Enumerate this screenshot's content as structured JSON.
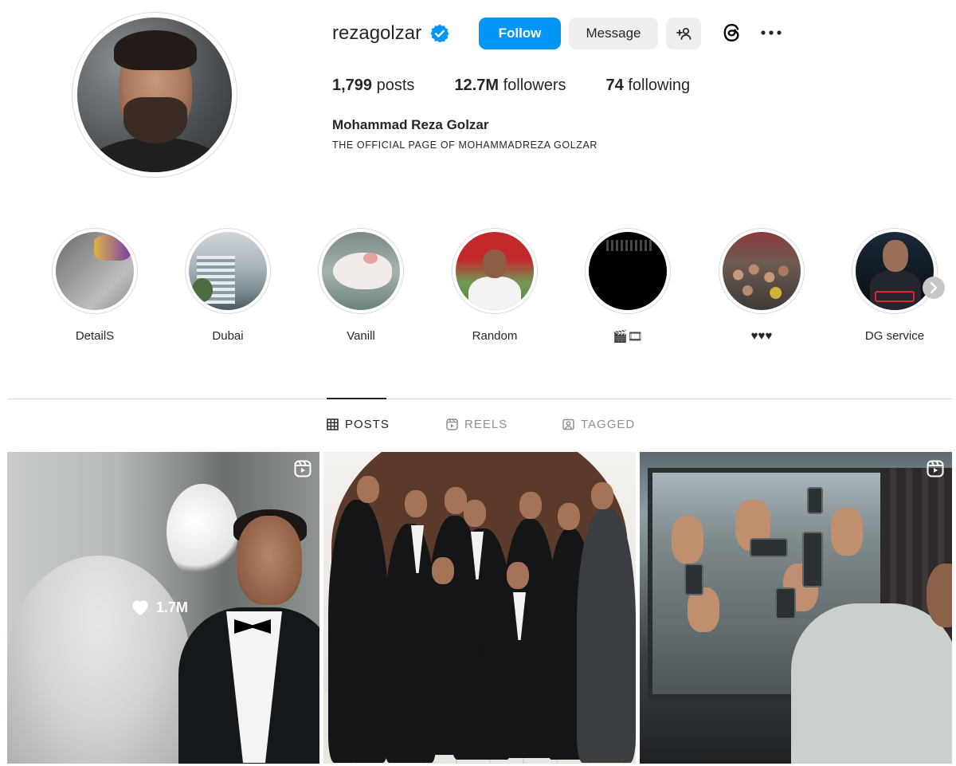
{
  "profile": {
    "username": "rezagolzar",
    "verified": true,
    "full_name": "Mohammad Reza Golzar",
    "bio": "THE OFFICIAL PAGE OF MOHAMMADREZA GOLZAR",
    "stats": {
      "posts_count": "1,799",
      "posts_label": "posts",
      "followers_count": "12.7M",
      "followers_label": "followers",
      "following_count": "74",
      "following_label": "following"
    }
  },
  "actions": {
    "follow_label": "Follow",
    "message_label": "Message",
    "add_user_icon": "person-add-icon",
    "threads_icon": "threads-icon",
    "more_icon": "more-options-icon"
  },
  "highlights": [
    {
      "label": "DetailS"
    },
    {
      "label": "Dubai"
    },
    {
      "label": "Vanill"
    },
    {
      "label": "Random"
    },
    {
      "label": "🎬🎞"
    },
    {
      "label": "♥♥♥"
    },
    {
      "label": "DG service"
    }
  ],
  "tabs": {
    "posts": "POSTS",
    "reels": "REELS",
    "tagged": "TAGGED",
    "active": "posts"
  },
  "posts": [
    {
      "type": "reel",
      "likes_overlay": "1.7M"
    },
    {
      "type": "photo"
    },
    {
      "type": "reel"
    }
  ],
  "colors": {
    "accent": "#0095f6",
    "text": "#262626",
    "muted": "#8e8e8e",
    "border": "#dbdbdb",
    "button_bg": "#efefef"
  }
}
